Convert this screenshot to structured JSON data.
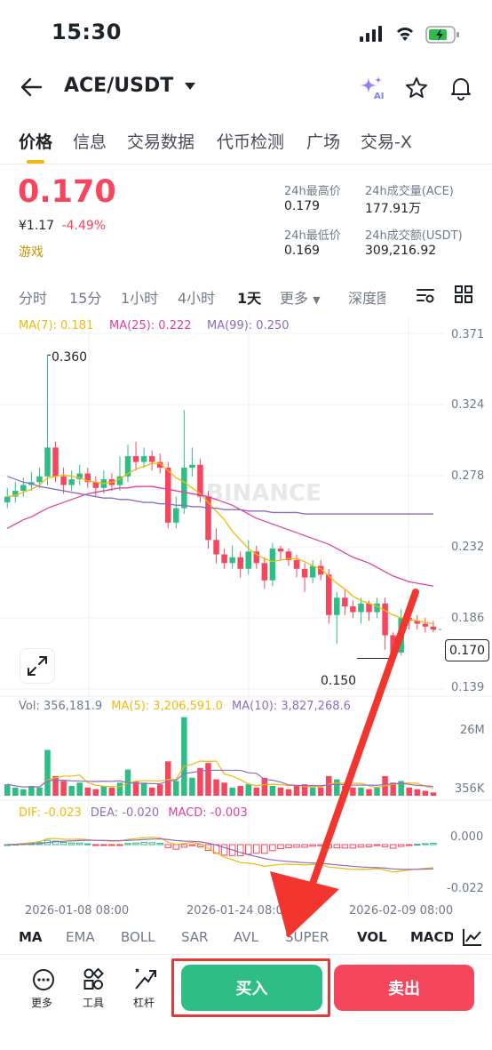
{
  "status": {
    "time": "15:30"
  },
  "header": {
    "pair": "ACE/USDT"
  },
  "tabs": [
    {
      "label": "价格"
    },
    {
      "label": "信息"
    },
    {
      "label": "交易数据"
    },
    {
      "label": "代币检测"
    },
    {
      "label": "广场"
    },
    {
      "label": "交易-X"
    }
  ],
  "price": {
    "last": "0.170",
    "fiat": "¥1.17",
    "change": "-4.49%",
    "category": "游戏"
  },
  "stats": {
    "high_label": "24h最高价",
    "high": "0.179",
    "low_label": "24h最低价",
    "low": "0.169",
    "vol_label": "24h成交量(ACE)",
    "vol": "177.91万",
    "amt_label": "24h成交额(USDT)",
    "amt": "309,216.92"
  },
  "timeframes": [
    "分时",
    "15分",
    "1小时",
    "4小时",
    "1天",
    "更多",
    "深度图"
  ],
  "active_timeframe": "1天",
  "ma_legend": {
    "ma7": "MA(7): 0.181",
    "ma25": "MA(25): 0.222",
    "ma99": "MA(99): 0.250"
  },
  "price_axis": [
    "0.371",
    "0.324",
    "0.278",
    "0.232",
    "0.186",
    "0.139"
  ],
  "price_tag": "0.170",
  "high_marker": "0.360",
  "low_marker": "0.150",
  "watermark": "BINANCE",
  "volume_legend": {
    "vol": "Vol: 356,181.9",
    "ma5": "MA(5): 3,206,591.0",
    "ma10": "MA(10): 3,827,268.6"
  },
  "volume_axis": [
    "26M",
    "356K"
  ],
  "macd_legend": {
    "dif": "DIF: -0.023",
    "dea": "DEA: -0.020",
    "macd": "MACD: -0.003"
  },
  "macd_axis": [
    "0.000",
    "-0.022"
  ],
  "dates": [
    "2026-01-08 08:00",
    "2026-01-24 08:00",
    "2026-02-09 08:00"
  ],
  "indicators": [
    "MA",
    "EMA",
    "BOLL",
    "SAR",
    "AVL",
    "SUPER",
    "VOL",
    "MACD"
  ],
  "bottom": {
    "more": "更多",
    "tools": "工具",
    "leverage": "杠杆",
    "buy": "买入",
    "sell": "卖出"
  },
  "colors": {
    "up": "#2ebd85",
    "down": "#f6465d",
    "ma7": "#f0b90b",
    "ma25": "#e040a0",
    "ma99": "#8e6cc4",
    "accent": "#f0b90b"
  },
  "chart_data": {
    "type": "candlestick",
    "candles": [
      [
        0.258,
        0.262,
        0.268,
        0.254
      ],
      [
        0.262,
        0.266,
        0.272,
        0.258
      ],
      [
        0.266,
        0.27,
        0.275,
        0.262
      ],
      [
        0.27,
        0.272,
        0.279,
        0.266
      ],
      [
        0.272,
        0.276,
        0.282,
        0.268
      ],
      [
        0.276,
        0.296,
        0.36,
        0.27
      ],
      [
        0.296,
        0.276,
        0.3,
        0.272
      ],
      [
        0.276,
        0.27,
        0.282,
        0.264
      ],
      [
        0.27,
        0.274,
        0.28,
        0.266
      ],
      [
        0.274,
        0.278,
        0.284,
        0.27
      ],
      [
        0.278,
        0.272,
        0.282,
        0.268
      ],
      [
        0.272,
        0.268,
        0.276,
        0.262
      ],
      [
        0.268,
        0.274,
        0.28,
        0.264
      ],
      [
        0.274,
        0.27,
        0.278,
        0.266
      ],
      [
        0.27,
        0.276,
        0.29,
        0.266
      ],
      [
        0.276,
        0.29,
        0.298,
        0.272
      ],
      [
        0.29,
        0.286,
        0.3,
        0.28
      ],
      [
        0.286,
        0.29,
        0.296,
        0.282
      ],
      [
        0.29,
        0.286,
        0.294,
        0.28
      ],
      [
        0.286,
        0.282,
        0.292,
        0.278
      ],
      [
        0.282,
        0.244,
        0.286,
        0.24
      ],
      [
        0.244,
        0.254,
        0.262,
        0.24
      ],
      [
        0.254,
        0.282,
        0.322,
        0.25
      ],
      [
        0.282,
        0.284,
        0.296,
        0.276
      ],
      [
        0.284,
        0.262,
        0.288,
        0.258
      ],
      [
        0.262,
        0.232,
        0.266,
        0.226
      ],
      [
        0.232,
        0.222,
        0.24,
        0.216
      ],
      [
        0.222,
        0.216,
        0.226,
        0.212
      ],
      [
        0.216,
        0.22,
        0.228,
        0.212
      ],
      [
        0.22,
        0.212,
        0.224,
        0.206
      ],
      [
        0.212,
        0.224,
        0.232,
        0.208
      ],
      [
        0.224,
        0.216,
        0.228,
        0.212
      ],
      [
        0.216,
        0.204,
        0.22,
        0.198
      ],
      [
        0.204,
        0.226,
        0.23,
        0.2
      ],
      [
        0.226,
        0.224,
        0.228,
        0.218
      ],
      [
        0.224,
        0.218,
        0.226,
        0.214
      ],
      [
        0.218,
        0.212,
        0.222,
        0.206
      ],
      [
        0.212,
        0.206,
        0.216,
        0.196
      ],
      [
        0.206,
        0.214,
        0.218,
        0.202
      ],
      [
        0.214,
        0.208,
        0.218,
        0.204
      ],
      [
        0.208,
        0.18,
        0.212,
        0.174
      ],
      [
        0.18,
        0.192,
        0.196,
        0.16
      ],
      [
        0.192,
        0.186,
        0.198,
        0.18
      ],
      [
        0.186,
        0.182,
        0.19,
        0.178
      ],
      [
        0.182,
        0.188,
        0.192,
        0.174
      ],
      [
        0.188,
        0.182,
        0.19,
        0.176
      ],
      [
        0.182,
        0.188,
        0.192,
        0.178
      ],
      [
        0.188,
        0.166,
        0.192,
        0.156
      ],
      [
        0.166,
        0.154,
        0.168,
        0.15
      ],
      [
        0.154,
        0.178,
        0.184,
        0.152
      ],
      [
        0.178,
        0.176,
        0.182,
        0.17
      ],
      [
        0.176,
        0.174,
        0.18,
        0.17
      ],
      [
        0.174,
        0.172,
        0.178,
        0.168
      ],
      [
        0.172,
        0.17,
        0.176,
        0.168
      ]
    ],
    "candle_format": [
      "open",
      "close",
      "high",
      "low"
    ],
    "ma7": [
      0.262,
      0.263,
      0.265,
      0.267,
      0.27,
      0.275,
      0.276,
      0.277,
      0.276,
      0.275,
      0.273,
      0.272,
      0.271,
      0.272,
      0.274,
      0.278,
      0.281,
      0.283,
      0.285,
      0.285,
      0.28,
      0.275,
      0.272,
      0.268,
      0.264,
      0.258,
      0.252,
      0.246,
      0.238,
      0.232,
      0.226,
      0.222,
      0.219,
      0.217,
      0.218,
      0.219,
      0.219,
      0.217,
      0.214,
      0.212,
      0.207,
      0.202,
      0.198,
      0.193,
      0.19,
      0.188,
      0.186,
      0.183,
      0.18,
      0.178,
      0.177,
      0.176,
      0.175,
      0.174
    ],
    "ma25": [
      0.24,
      0.243,
      0.246,
      0.248,
      0.251,
      0.254,
      0.256,
      0.258,
      0.26,
      0.262,
      0.264,
      0.265,
      0.266,
      0.267,
      0.268,
      0.268,
      0.269,
      0.269,
      0.269,
      0.268,
      0.267,
      0.266,
      0.265,
      0.264,
      0.263,
      0.262,
      0.26,
      0.258,
      0.256,
      0.253,
      0.25,
      0.247,
      0.245,
      0.243,
      0.241,
      0.239,
      0.237,
      0.235,
      0.233,
      0.231,
      0.229,
      0.226,
      0.223,
      0.22,
      0.218,
      0.216,
      0.213,
      0.21,
      0.207,
      0.205,
      0.203,
      0.202,
      0.201,
      0.2
    ],
    "ma99": [
      0.276,
      0.274,
      0.272,
      0.271,
      0.269,
      0.268,
      0.267,
      0.266,
      0.265,
      0.264,
      0.263,
      0.262,
      0.261,
      0.261,
      0.26,
      0.26,
      0.259,
      0.258,
      0.258,
      0.257,
      0.257,
      0.256,
      0.256,
      0.255,
      0.255,
      0.254,
      0.254,
      0.253,
      0.253,
      0.253,
      0.252,
      0.252,
      0.252,
      0.251,
      0.251,
      0.251,
      0.251,
      0.25,
      0.25,
      0.25,
      0.25,
      0.25,
      0.25,
      0.25,
      0.25,
      0.25,
      0.25,
      0.25,
      0.25,
      0.25,
      0.25,
      0.25,
      0.25,
      0.25
    ],
    "volume": [
      0.14,
      0.1,
      0.08,
      0.12,
      0.1,
      0.56,
      0.24,
      0.18,
      0.12,
      0.16,
      0.1,
      0.08,
      0.12,
      0.1,
      0.16,
      0.32,
      0.18,
      0.16,
      0.1,
      0.14,
      0.42,
      0.18,
      0.96,
      0.22,
      0.34,
      0.4,
      0.2,
      0.16,
      0.1,
      0.12,
      0.14,
      0.1,
      0.22,
      0.12,
      0.1,
      0.08,
      0.12,
      0.14,
      0.1,
      0.1,
      0.24,
      0.2,
      0.12,
      0.1,
      0.1,
      0.08,
      0.1,
      0.24,
      0.16,
      0.18,
      0.1,
      0.08,
      0.06,
      0.04
    ],
    "y_range": [
      0.13,
      0.375
    ]
  }
}
